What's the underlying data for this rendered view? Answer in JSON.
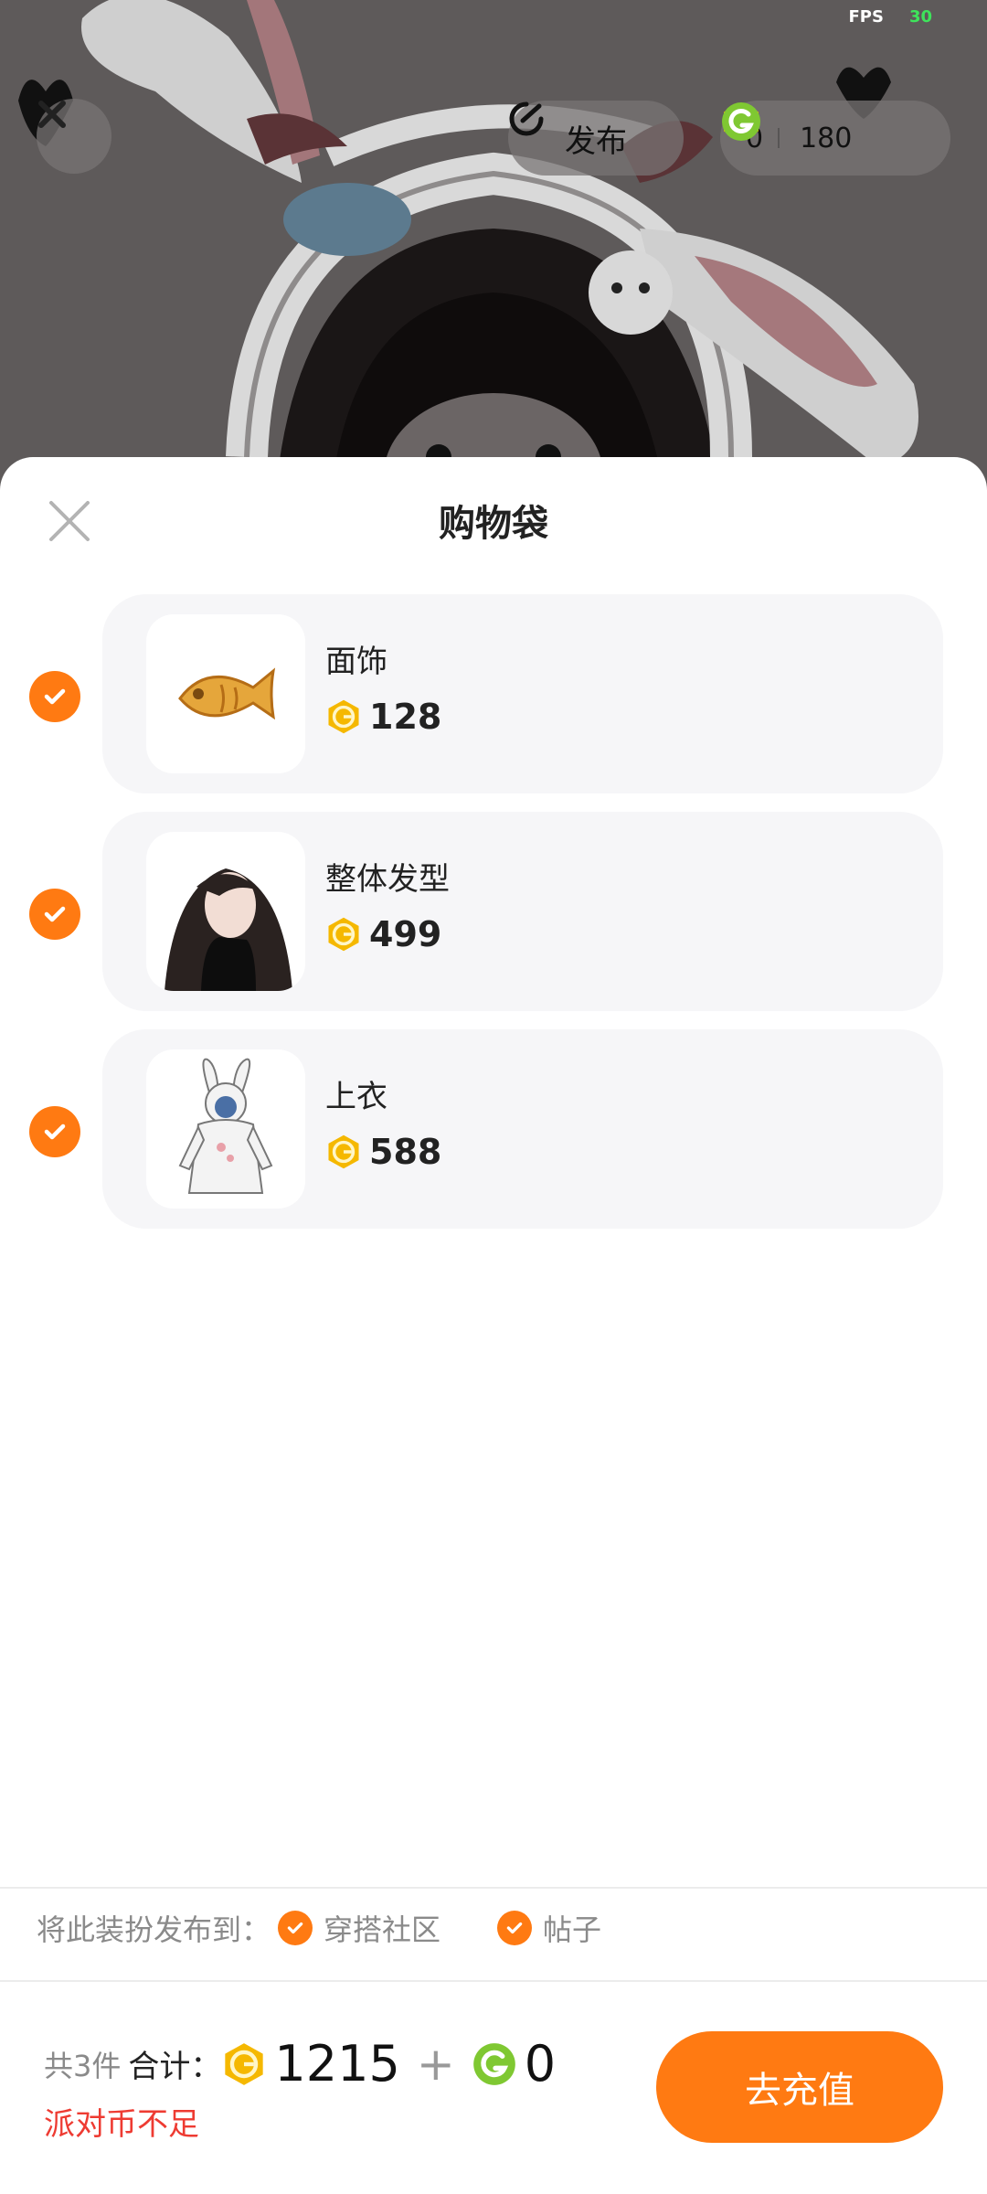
{
  "status": {
    "fps_label": "FPS",
    "fps_value": "30"
  },
  "top_bar": {
    "publish_label": "发布",
    "gold_coins": "0",
    "green_coins": "180"
  },
  "sheet": {
    "title": "购物袋",
    "items": [
      {
        "name": "面饰",
        "price": "128",
        "thumb_icon": "fish-face-ornament-icon",
        "checked": true
      },
      {
        "name": "整体发型",
        "price": "499",
        "thumb_icon": "long-hair-icon",
        "checked": true
      },
      {
        "name": "上衣",
        "price": "588",
        "thumb_icon": "bunny-hoodie-icon",
        "checked": true
      }
    ],
    "publish_to": {
      "prefix": "将此装扮发布到：",
      "options": [
        {
          "label": "穿搭社区",
          "checked": true
        },
        {
          "label": "帖子",
          "checked": true
        }
      ]
    },
    "summary": {
      "count": "共3件",
      "total_label": "合计：",
      "gold_total": "1215",
      "plus": "+",
      "green_total": "0",
      "warning": "派对币不足"
    },
    "recharge_label": "去充值"
  },
  "colors": {
    "accent": "#ff7a12",
    "gold_coin": "#f5b800",
    "green_coin": "#7fc832",
    "warning": "#ee3b32"
  }
}
